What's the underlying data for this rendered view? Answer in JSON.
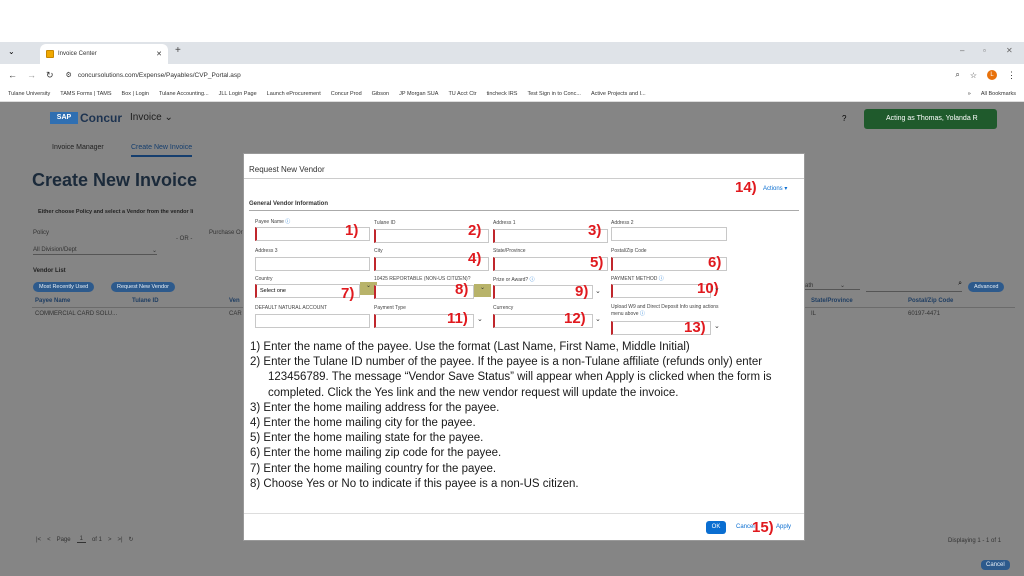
{
  "browser": {
    "tab_title": "Invoice Center",
    "url": "concursolutions.com/Expense/Payables/CVP_Portal.asp",
    "bookmarks": [
      "Tulane University",
      "TAMS Forms | TAMS",
      "Box | Login",
      "Tulane Accounting...",
      "JLL Login Page",
      "Launch eProcurement",
      "Concur Prod",
      "Gibson",
      "JP Morgan SUA",
      "TU Acct Ctr",
      "tincheck IRS",
      "Test Sign in to Conc...",
      "Active Projects and I..."
    ],
    "all_bookmarks": "All Bookmarks",
    "profile_initial": "L"
  },
  "app": {
    "brand": "Concur",
    "brand_prefix": "SAP",
    "module": "Invoice",
    "acting_as": "Acting as Thomas, Yolanda R",
    "tabs": [
      "Invoice Manager",
      "Create New Invoice"
    ],
    "page_title": "Create New Invoice",
    "notice": "Either choose Policy and select a Vendor from the vendor li",
    "policy_label": "Policy",
    "purchase_label": "Purchase Or",
    "or_text": "- OR -",
    "policy_value": "All Division/Dept",
    "vendor_list_label": "Vendor List",
    "most_recent": "Most Recently Used",
    "request_vendor": "Request New Vendor",
    "search_col": "ath",
    "advanced": "Advanced",
    "table_headers": [
      "Payee Name",
      "Tulane ID",
      "Ven",
      "State/Province",
      "Postal/Zip Code"
    ],
    "table_row": [
      "COMMERCIAL CARD SOLU...",
      "",
      "CAR",
      "IL",
      "60197-4471"
    ],
    "pager_page": "Page",
    "pager_num": "1",
    "pager_of": "of 1",
    "displaying": "Displaying 1 - 1 of 1",
    "cancel": "Cancel"
  },
  "modal": {
    "title": "Request New Vendor",
    "actions": "Actions",
    "section": "General Vendor Information",
    "fields": {
      "payee_name": "Payee Name",
      "tulane_id": "Tulane ID",
      "address1": "Address 1",
      "address2": "Address 2",
      "address3": "Address 3",
      "city": "City",
      "state": "State/Province",
      "postal": "Postal/Zip Code",
      "country": "Country",
      "country_value": "Select one",
      "reportable": "10425 REPORTABLE (NON-US CITIZEN)?",
      "prize": "Prize or Award?",
      "payment_method": "PAYMENT METHOD",
      "default_account": "DEFAULT NATURAL ACCOUNT",
      "payment_type": "Payment Type",
      "currency": "Currency",
      "upload_w9": "Upload W9 and Direct Deposit Info using actions menu above"
    },
    "numbers": [
      "1)",
      "2)",
      "3)",
      "4)",
      "5)",
      "6)",
      "7)",
      "8)",
      "9)",
      "10)",
      "11)",
      "12)",
      "13)",
      "14)",
      "15)"
    ],
    "ok": "OK",
    "cancel": "Cancel",
    "apply": "Apply",
    "instructions": [
      "1)  Enter the name of the payee.  Use the format  (Last Name, First Name, Middle Initial)",
      "2)  Enter the Tulane ID number of the payee.  If the payee is a non-Tulane affiliate (refunds only) enter 123456789.  The message “Vendor Save Status” will appear when Apply is clicked when the form is completed.  Click the Yes link and the new vendor request will update the invoice.",
      "3)  Enter the home mailing address for the payee.",
      "4)  Enter the home mailing city for the payee.",
      "5)  Enter the home mailing state for the payee.",
      "6)  Enter the home mailing zip code for the payee.",
      "7)  Enter the home mailing country for the payee.",
      "8)  Choose Yes or No to indicate if this payee is a non-US citizen."
    ]
  }
}
